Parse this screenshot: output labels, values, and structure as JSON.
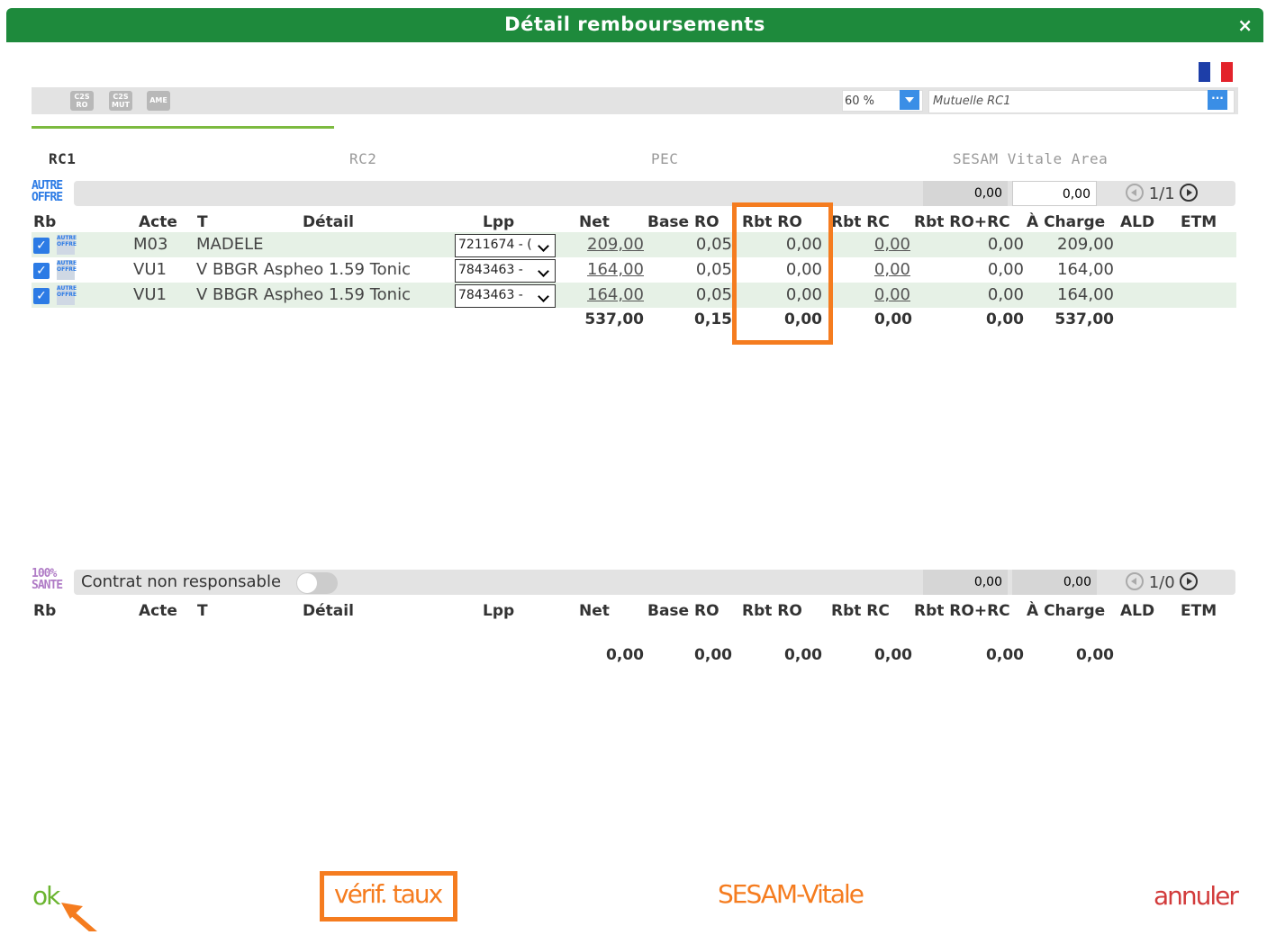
{
  "window": {
    "title": "Détail remboursements",
    "close_glyph": "×"
  },
  "toolbar": {
    "icons": [
      {
        "name": "c2s-ro-icon",
        "label": "C2S RO"
      },
      {
        "name": "c2s-mut-icon",
        "label": "C2S MUT"
      },
      {
        "name": "ame-icon",
        "label": "AME"
      }
    ],
    "rate": "60 %",
    "mutuelle_placeholder": "Mutuelle RC1",
    "mutuelle_btn": "···"
  },
  "tabs": [
    {
      "label": "RC1",
      "active": true
    },
    {
      "label": "RC2",
      "active": false
    },
    {
      "label": "PEC",
      "active": false
    },
    {
      "label": "SESAM Vitale Area",
      "active": false
    }
  ],
  "section1": {
    "badge": "AUTRE OFFRE",
    "sum1": "0,00",
    "sum2": "0,00",
    "pager": "1/1",
    "headers": [
      "Rb",
      "Acte",
      "T",
      "Détail",
      "Lpp",
      "Net",
      "Base RO",
      "Rbt RO",
      "Rbt RC",
      "Rbt RO+RC",
      "À Charge",
      "ALD",
      "ETM"
    ],
    "rows": [
      {
        "acte": "M03",
        "detail": "MADELE",
        "lpp": "7211674 - (",
        "net": "209,00",
        "base_ro": "0,05",
        "rbt_ro": "0,00",
        "rbt_rc": "0,00",
        "rbt_ro_rc": "0,00",
        "a_charge": "209,00"
      },
      {
        "acte": "VU1",
        "detail": "V BBGR Aspheo 1.59 Tonic",
        "lpp": "7843463 -",
        "net": "164,00",
        "base_ro": "0,05",
        "rbt_ro": "0,00",
        "rbt_rc": "0,00",
        "rbt_ro_rc": "0,00",
        "a_charge": "164,00"
      },
      {
        "acte": "VU1",
        "detail": "V BBGR Aspheo 1.59 Tonic",
        "lpp": "7843463 -",
        "net": "164,00",
        "base_ro": "0,05",
        "rbt_ro": "0,00",
        "rbt_rc": "0,00",
        "rbt_ro_rc": "0,00",
        "a_charge": "164,00"
      }
    ],
    "totals": {
      "net": "537,00",
      "base_ro": "0,15",
      "rbt_ro": "0,00",
      "rbt_rc": "0,00",
      "rbt_ro_rc": "0,00",
      "a_charge": "537,00"
    }
  },
  "section2": {
    "badge": "100% SANTE",
    "toggle_label": "Contrat non responsable",
    "sum1": "0,00",
    "sum2": "0,00",
    "pager": "1/0",
    "headers": [
      "Rb",
      "Acte",
      "T",
      "Détail",
      "Lpp",
      "Net",
      "Base RO",
      "Rbt RO",
      "Rbt RC",
      "Rbt RO+RC",
      "À Charge",
      "ALD",
      "ETM"
    ],
    "totals": {
      "net": "0,00",
      "base_ro": "0,00",
      "rbt_ro": "0,00",
      "rbt_rc": "0,00",
      "rbt_ro_rc": "0,00",
      "a_charge": "0,00"
    }
  },
  "footer": {
    "ok": "ok",
    "verif": "vérif. taux",
    "sesam": "SESAM-Vitale",
    "annuler": "annuler"
  },
  "colors": {
    "title_bg": "#1e8a3c",
    "accent_green": "#7cba3f",
    "highlight": "#f57c1f",
    "link_blue": "#2c7be5",
    "annuler_red": "#d23b3b"
  }
}
